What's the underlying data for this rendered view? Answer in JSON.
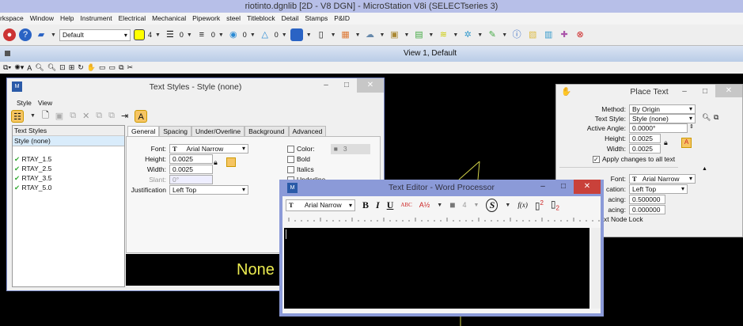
{
  "app": {
    "title": "riotinto.dgnlib [2D - V8 DGN] - MicroStation V8i (SELECTseries 3)"
  },
  "menu": [
    "rkspace",
    "Window",
    "Help",
    "Instrument",
    "Electrical",
    "Mechanical",
    "Pipework",
    "steel",
    "Titleblock",
    "Detail",
    "Stamps",
    "P&ID"
  ],
  "toolbar": {
    "level": "Default",
    "color": "4",
    "style": "0",
    "weight": "0",
    "transparency": "0",
    "priority": "0",
    "active_color_hex": "#ffff00"
  },
  "view": {
    "title": "View 1, Default"
  },
  "text_styles": {
    "title": "Text Styles - Style (none)",
    "menu": [
      "Style",
      "View"
    ],
    "list_header": "Text Styles",
    "selected": "Style (none)",
    "styles": [
      "RTAY_1.5",
      "RTAY_2.5",
      "RTAY_3.5",
      "RTAY_5.0"
    ],
    "tabs": [
      "General",
      "Spacing",
      "Under/Overline",
      "Background",
      "Advanced"
    ],
    "font_label": "Font:",
    "font": "Arial Narrow",
    "height_label": "Height:",
    "height": "0.0025",
    "width_label": "Width:",
    "width": "0.0025",
    "slant_label": "Slant:",
    "slant": "0°",
    "justification_label": "Justification",
    "justification": "Left Top",
    "color_label": "Color:",
    "color_value": "3",
    "bold": "Bold",
    "italics": "Italics",
    "underline": "Underline",
    "preview": "None"
  },
  "place_text": {
    "title": "Place Text",
    "method_label": "Method:",
    "method": "By Origin",
    "style_label": "Text Style:",
    "style": "Style (none)",
    "angle_label": "Active Angle:",
    "angle": "0.0000°",
    "height_label": "Height:",
    "height": "0.0025",
    "width_label": "Width:",
    "width": "0.0025",
    "apply_all": "Apply changes to all text",
    "apply_all_checked": true,
    "font_label": "Font:",
    "font": "Arial Narrow",
    "just_label": "cation:",
    "justification": "Left Top",
    "line_spacing_label": "acing:",
    "line_spacing": "0.500000",
    "inter_spacing_label": "acing:",
    "inter_spacing": "0.000000",
    "node_lock": "xt Node Lock"
  },
  "text_editor": {
    "title": "Text Editor - Word Processor",
    "font": "Arial Narrow",
    "bold": "B",
    "italic": "I",
    "underline": "U",
    "spell": "ABC",
    "fraction": "A½",
    "color": "4",
    "fx": "f(x)"
  }
}
